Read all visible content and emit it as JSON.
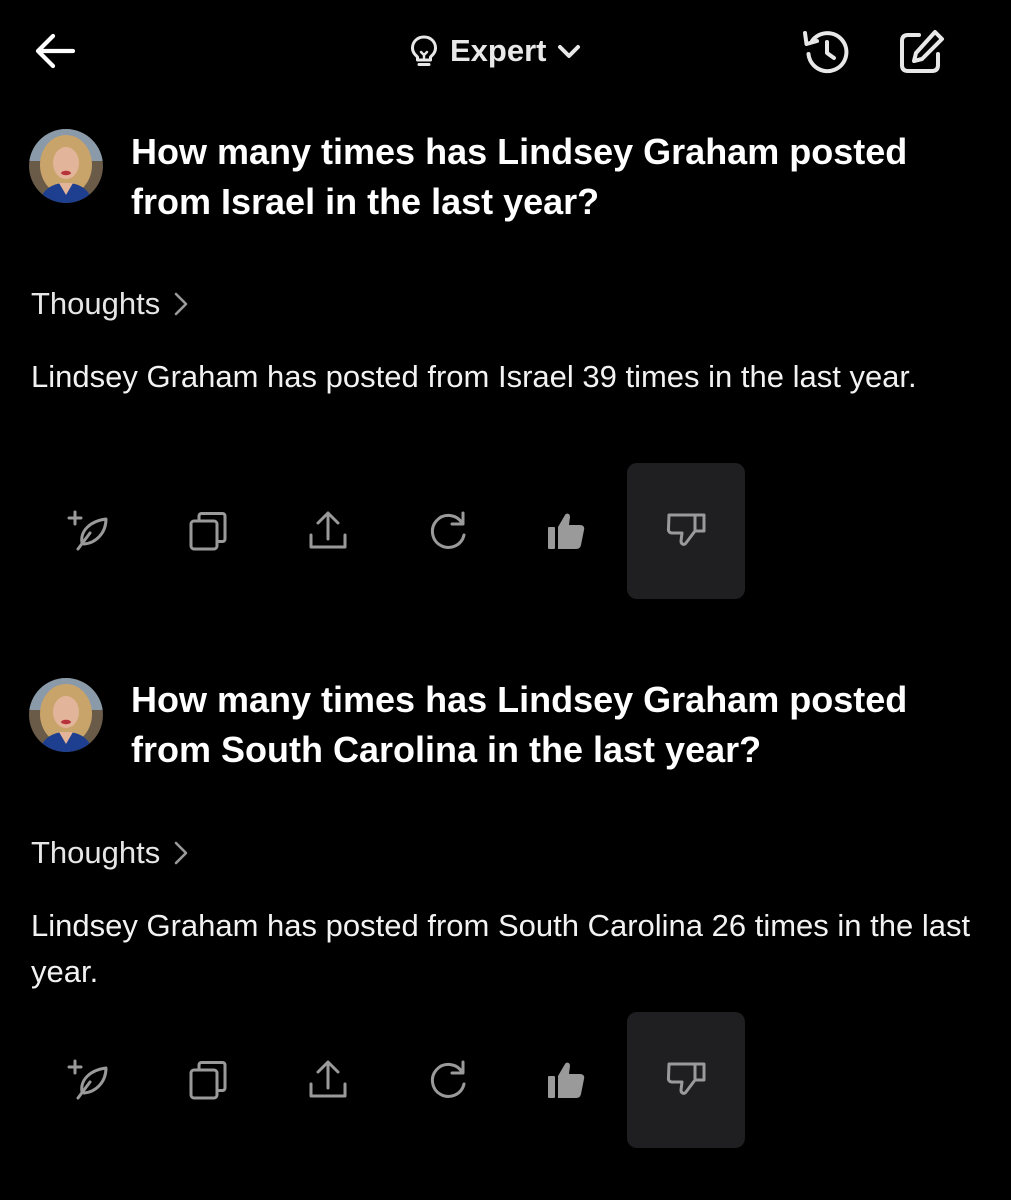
{
  "header": {
    "back_icon": "arrow-left-icon",
    "mode_icon": "lightbulb-icon",
    "mode_label": "Expert",
    "mode_dropdown_icon": "chevron-down-icon",
    "history_icon": "history-icon",
    "new_chat_icon": "edit-icon"
  },
  "conversation": [
    {
      "question": "How many times has Lindsey Graham posted from Israel in the last year?",
      "thoughts_label": "Thoughts",
      "answer": "Lindsey Graham has posted from Israel 39 times in the last year.",
      "actions": [
        "add-quill-icon",
        "copy-icon",
        "share-icon",
        "regenerate-icon",
        "thumbs-up-icon",
        "thumbs-down-icon"
      ],
      "selected_action": "thumbs-down-icon"
    },
    {
      "question": "How many times has Lindsey Graham posted from South Carolina in the last year?",
      "thoughts_label": "Thoughts",
      "answer": "Lindsey Graham has posted from South Carolina 26 times in the last year.",
      "actions": [
        "add-quill-icon",
        "copy-icon",
        "share-icon",
        "regenerate-icon",
        "thumbs-up-icon",
        "thumbs-down-icon"
      ],
      "selected_action": "thumbs-down-icon"
    }
  ],
  "colors": {
    "background": "#000000",
    "text": "#ffffff",
    "icon": "#9a9a9a",
    "selected_action_bg": "#1f1f21"
  }
}
